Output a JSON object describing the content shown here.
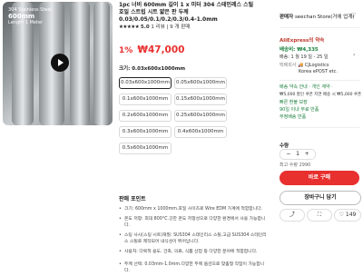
{
  "image": {
    "label_line1": "304 Stainless Steel",
    "label_line2": "600mm",
    "label_line3": "Length 1 Meter"
  },
  "product": {
    "title": "1pc 너비 600mm 길이 1 x 미터 304 스테인레스 스틸 호일 스트립 시트 얇은 판 두께 0.03/0.05/0.1/0.2/0.3/0.4-1.0mm",
    "stars": "★★★★★",
    "rating": "5.0",
    "reviews": "1 리뷰",
    "sold": "9 개 판매",
    "discount": "1%",
    "price": "₩47,000",
    "size_label": "크기: 0.03x600x1000mm"
  },
  "options": [
    "0.03x600x1000mm",
    "0.05x600x1000mm",
    "0.1x600x1000mm",
    "0.15x600x1000mm",
    "0.2x600x1000mm",
    "0.25x600x1000mm",
    "0.3x600x1000mm",
    "0.4x600x1000mm",
    "0.5x600x1000mm"
  ],
  "highlights": {
    "title": "판매 포인트",
    "items": [
      "크기: 600mm x 1000mm.호일 사이즈로 Wire EDM 가계에 적합합니다.",
      "온도 저항: 최대 800°C.강한 온도 저항성으로 다양한 환경에서 사용 가능합니다.",
      "스팅 사시(스팅 시트)재질: SUS304 스테인리스 스틸.고급 SUS304 스테인리스 스틸로 제작되어 내식성이 뛰어납니다.",
      "사용처: 다목적 용도. 건축, 의료, 식품 산업 등 다양한 분야에 적합합니다.",
      "두께 선택: 0.03mm-1.0mm.다양한 두께 옵션으로 맞춤형 작업이 가능합니다."
    ]
  },
  "seller": {
    "label": "판매자",
    "name": "seechan Store(거에 업계)"
  },
  "shipping": {
    "brand": "AliExpress의 약속",
    "fee_label": "배송비: ₩4,335",
    "delivery": "배송: 1 월 19 일 - 25 일",
    "logistics_label": "택배회사",
    "logistics": "CJLogistics",
    "logistics2": "Korea ePOST etc.",
    "assurance": "배송 약속 안내 · 개인 계약 ·",
    "line1": "₩5,000 할인 쿠폰 지연 배송 시 ₩5,000 쿠폰",
    "line2": "빠른 환불 보장",
    "line3": "90일 이내 무료 반품",
    "line4": "부정배송 반품"
  },
  "purchase": {
    "qty_label": "수량",
    "qty": "1",
    "stock": "최고 수량 2990",
    "buy": "바로 구매",
    "cart": "장바구니 담기",
    "likes": "149"
  }
}
